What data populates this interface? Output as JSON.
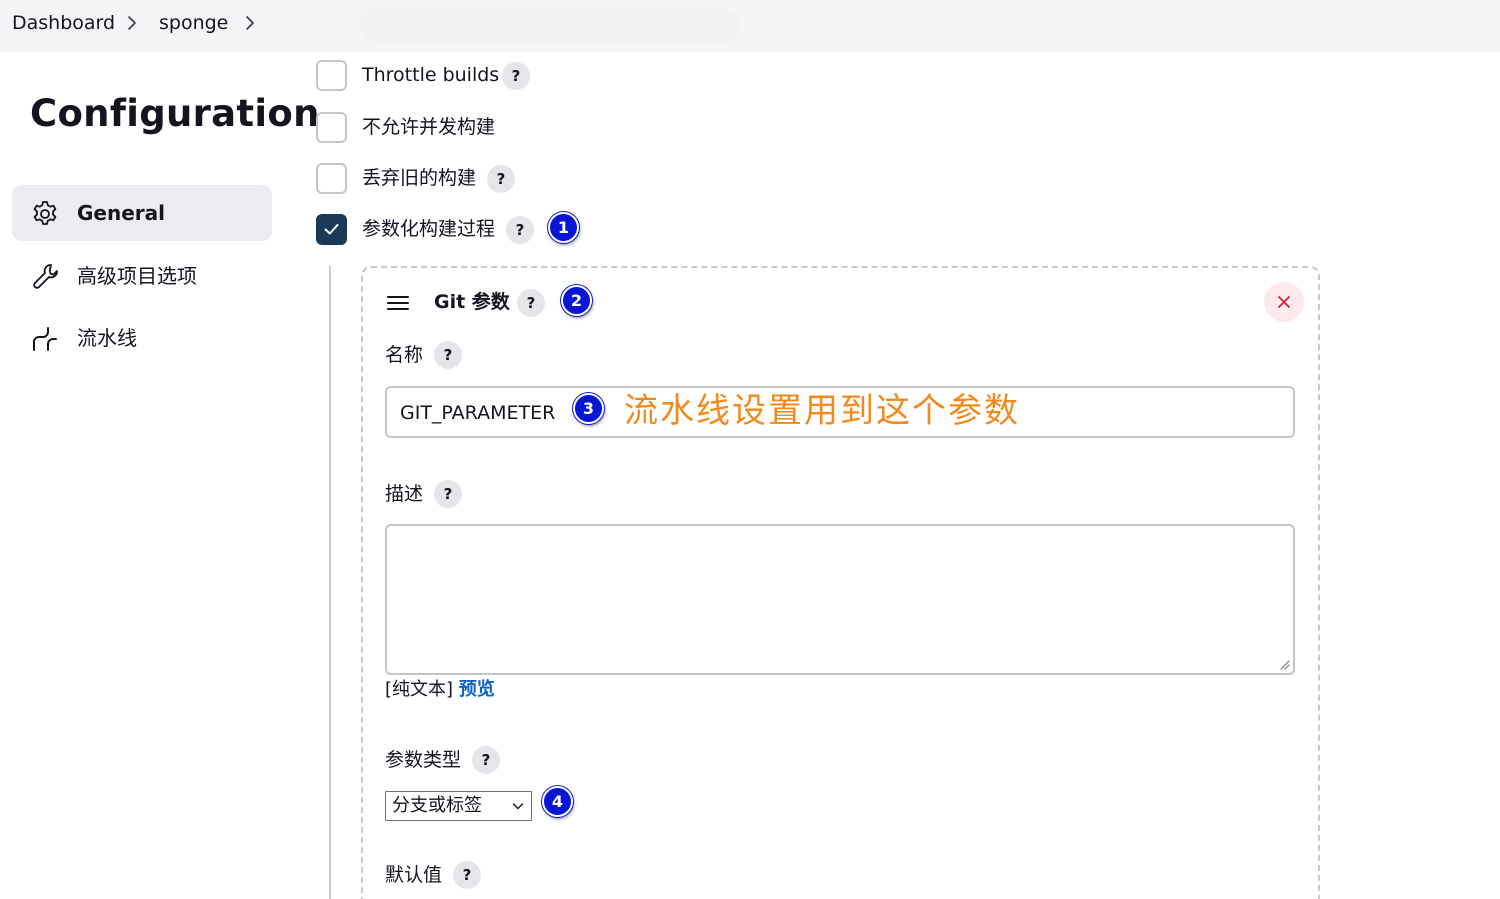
{
  "breadcrumb": {
    "items": [
      "Dashboard",
      "sponge"
    ]
  },
  "sidebar": {
    "title": "Configuration",
    "items": [
      {
        "label": "General",
        "icon": "gear-icon",
        "active": true
      },
      {
        "label": "高级项目选项",
        "icon": "wrench-icon",
        "active": false
      },
      {
        "label": "流水线",
        "icon": "pipeline-icon",
        "active": false
      }
    ]
  },
  "options": [
    {
      "label": "Throttle builds",
      "checked": false,
      "help": "?"
    },
    {
      "label": "不允许并发构建",
      "checked": false
    },
    {
      "label": "丢弃旧的构建",
      "checked": false,
      "help": "?"
    },
    {
      "label": "参数化构建过程",
      "checked": true,
      "help": "?",
      "badge": "1"
    }
  ],
  "parameter": {
    "title": "Git 参数",
    "help": "?",
    "badge": "2",
    "name": {
      "label": "名称",
      "help": "?",
      "value": "GIT_PARAMETER",
      "badge": "3",
      "annotation": "流水线设置用到这个参数"
    },
    "description": {
      "label": "描述",
      "help": "?",
      "value": ""
    },
    "format": {
      "plain": "[纯文本]",
      "preview": "预览"
    },
    "param_type": {
      "label": "参数类型",
      "help": "?",
      "selected": "分支或标签",
      "badge": "4"
    },
    "default_value": {
      "label": "默认值",
      "help": "?"
    }
  },
  "colors": {
    "checkbox_checked": "#1b3a57",
    "badge": "#0a16d6",
    "annotation": "#f08a1c",
    "link": "#0b63c9",
    "close": "#d21f3c"
  }
}
